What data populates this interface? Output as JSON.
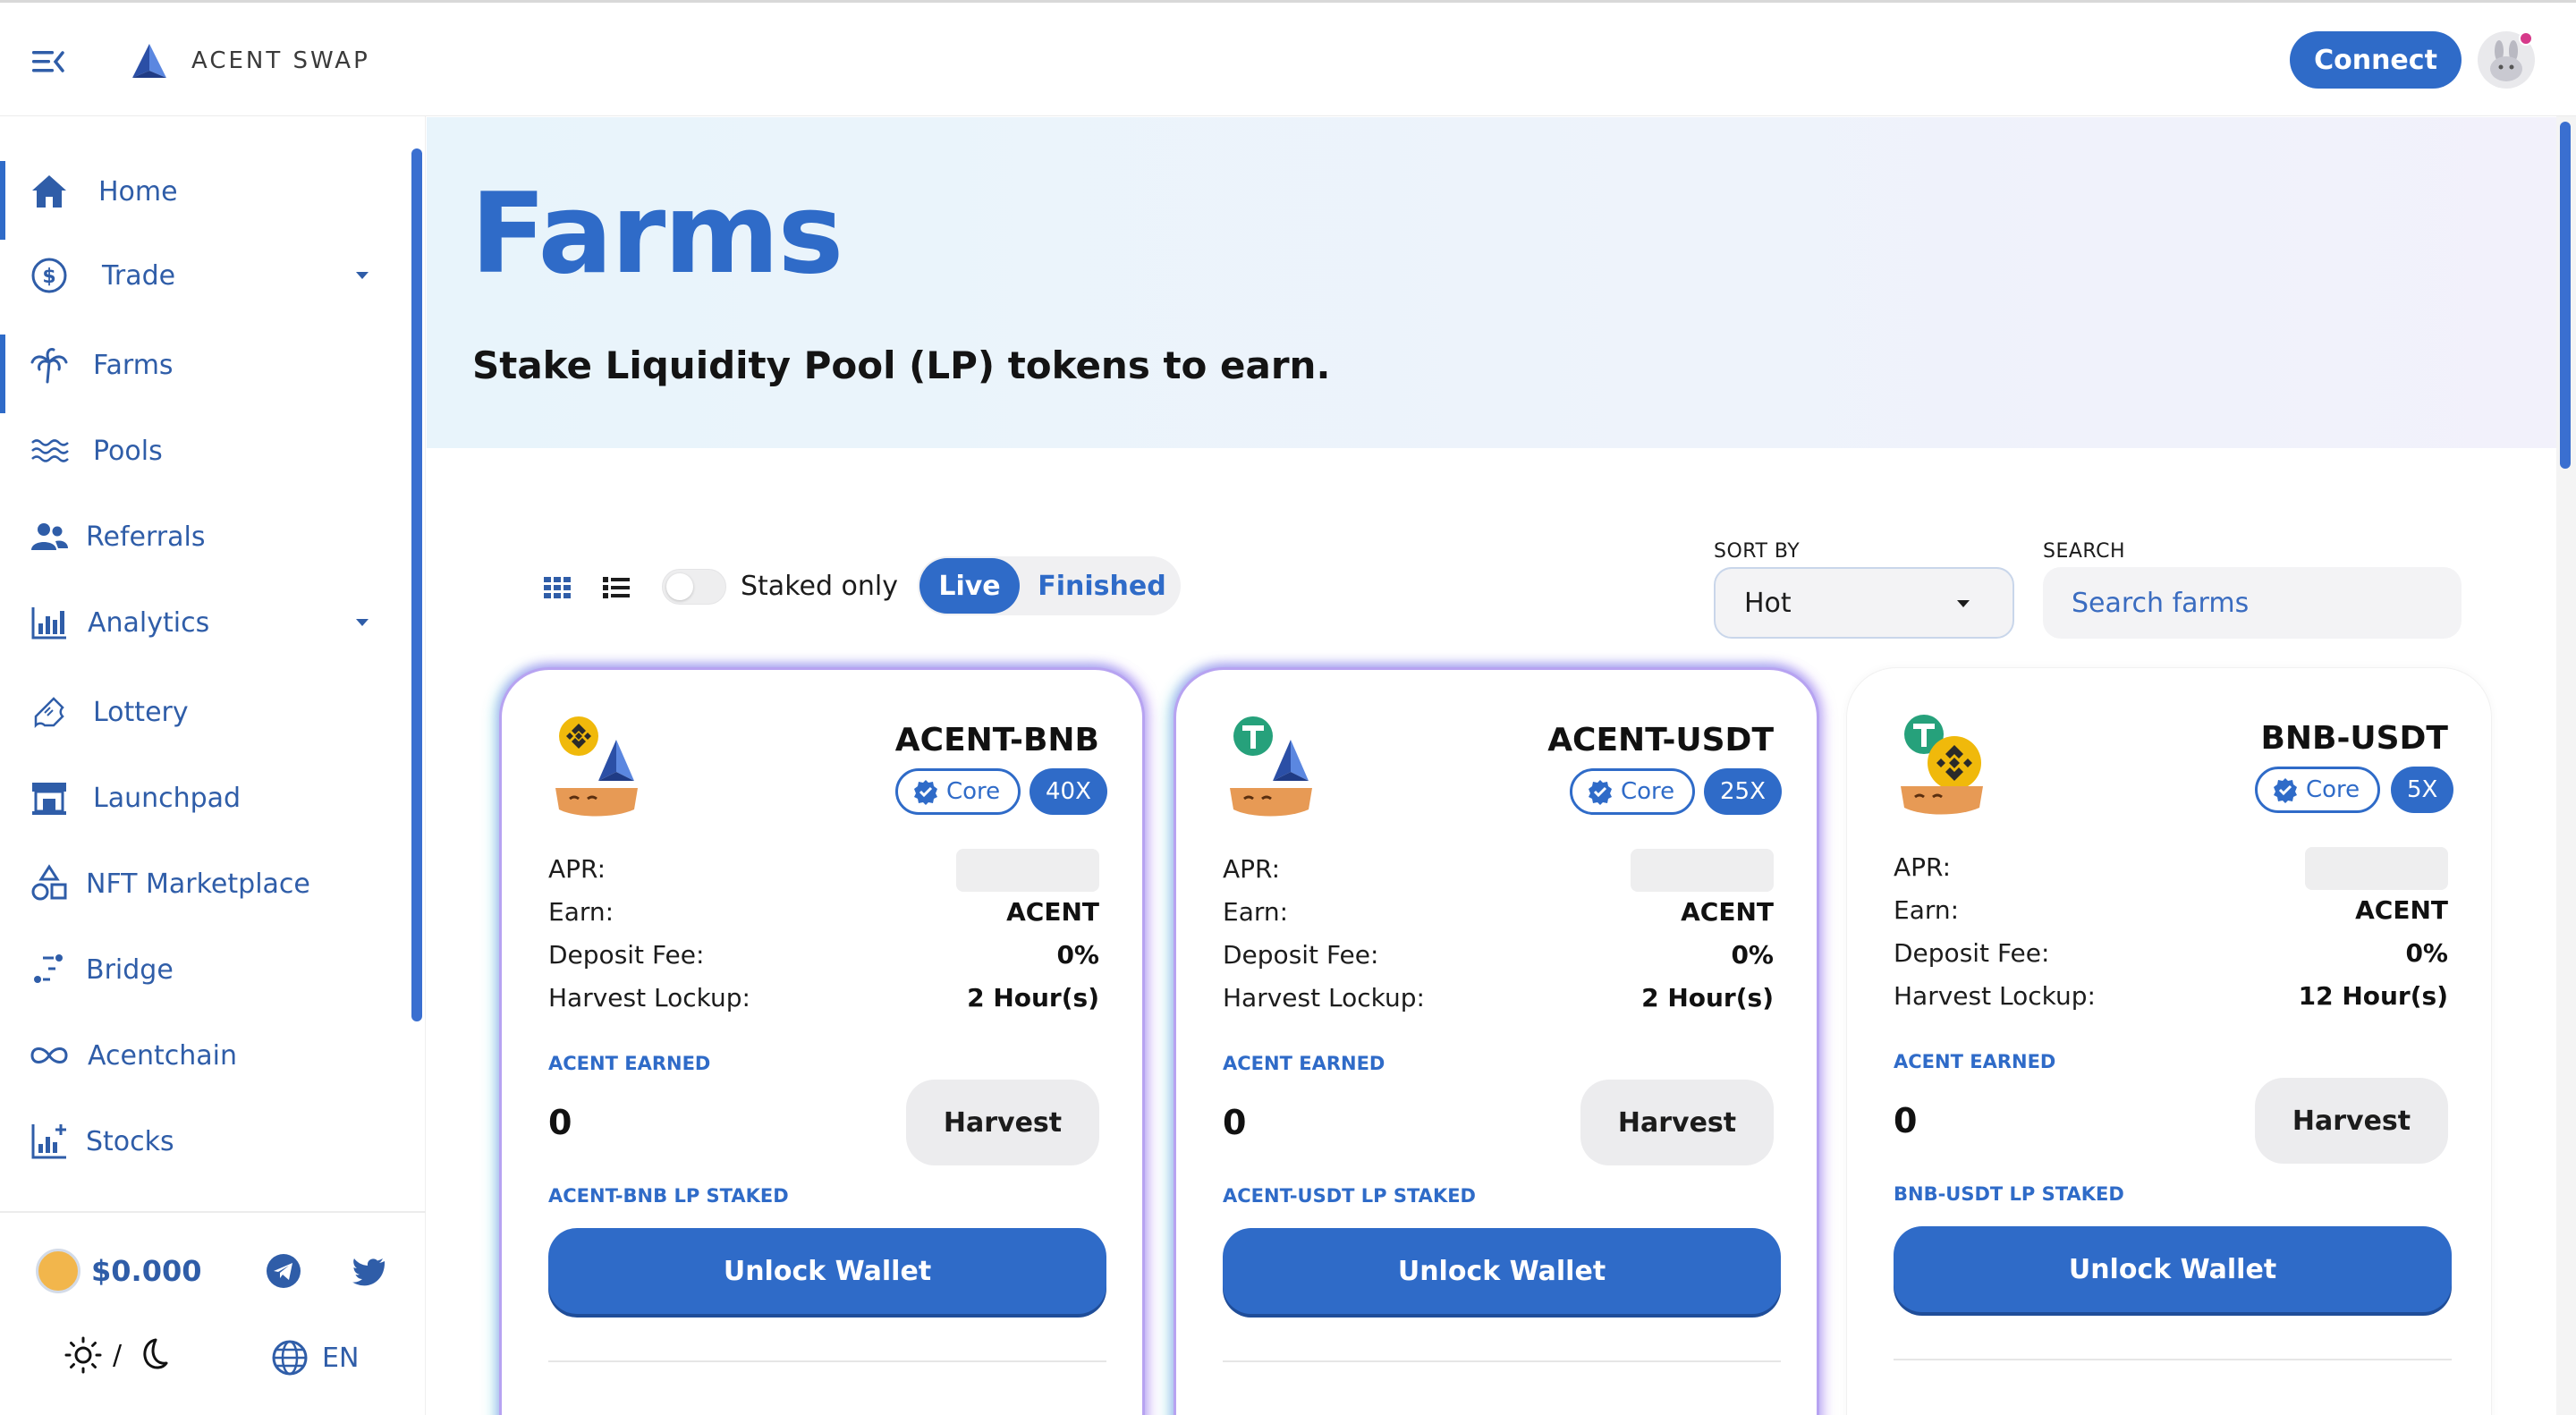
{
  "header": {
    "brand": "ACENT SWAP",
    "connect_label": "Connect"
  },
  "sidebar": {
    "items": [
      {
        "label": "Home",
        "icon": "home-icon"
      },
      {
        "label": "Trade",
        "icon": "trade-icon"
      },
      {
        "label": "Farms",
        "icon": "palm-tree-icon"
      },
      {
        "label": "Pools",
        "icon": "waves-icon"
      },
      {
        "label": "Referrals",
        "icon": "users-icon"
      },
      {
        "label": "Analytics",
        "icon": "chart-icon"
      },
      {
        "label": "Lottery",
        "icon": "ticket-icon"
      },
      {
        "label": "Launchpad",
        "icon": "storefront-icon"
      },
      {
        "label": "NFT Marketplace",
        "icon": "shapes-icon"
      },
      {
        "label": "Bridge",
        "icon": "bridge-icon"
      },
      {
        "label": "Acentchain",
        "icon": "infinity-icon"
      },
      {
        "label": "Stocks",
        "icon": "stocks-icon"
      }
    ],
    "price": "$0.000",
    "language": "EN",
    "theme_separator": "/"
  },
  "hero": {
    "title": "Farms",
    "subtitle": "Stake Liquidity Pool (LP) tokens to earn."
  },
  "filters": {
    "staked_only_label": "Staked only",
    "live_label": "Live",
    "finished_label": "Finished",
    "sort_by_label": "SORT BY",
    "sort_value": "Hot",
    "search_label": "SEARCH",
    "search_placeholder": "Search farms"
  },
  "labels": {
    "apr": "APR:",
    "earn": "Earn:",
    "deposit_fee": "Deposit Fee:",
    "harvest_lockup": "Harvest Lockup:",
    "acent_earned": "ACENT EARNED",
    "harvest": "Harvest",
    "unlock_wallet": "Unlock Wallet",
    "core": "Core"
  },
  "farms": [
    {
      "pair": "ACENT-BNB",
      "multiplier": "40X",
      "earn": "ACENT",
      "deposit_fee": "0%",
      "harvest_lockup": "2 Hour(s)",
      "earned": "0",
      "lp_staked_label": "ACENT-BNB LP STAKED"
    },
    {
      "pair": "ACENT-USDT",
      "multiplier": "25X",
      "earn": "ACENT",
      "deposit_fee": "0%",
      "harvest_lockup": "2 Hour(s)",
      "earned": "0",
      "lp_staked_label": "ACENT-USDT LP STAKED"
    },
    {
      "pair": "BNB-USDT",
      "multiplier": "5X",
      "earn": "ACENT",
      "deposit_fee": "0%",
      "harvest_lockup": "12 Hour(s)",
      "earned": "0",
      "lp_staked_label": "BNB-USDT LP STAKED"
    }
  ],
  "colors": {
    "accent": "#2f6bc8",
    "bnb": "#f0b90b",
    "usdt": "#26a17b"
  }
}
